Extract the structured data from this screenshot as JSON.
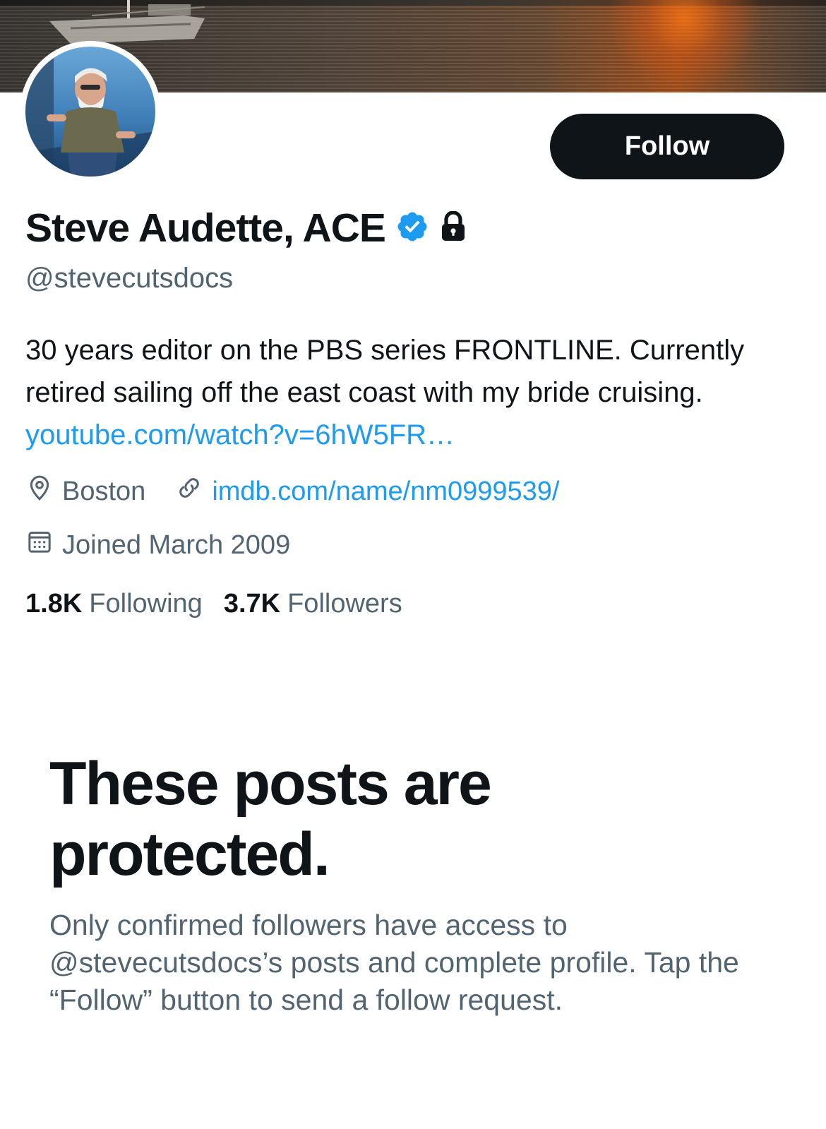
{
  "profile": {
    "name": "Steve Audette, ACE",
    "handle": "@stevecutsdocs",
    "follow_label": "Follow",
    "verified_icon": "verified-badge-icon",
    "lock_icon": "lock-icon",
    "bio_text": "30 years editor on the PBS series FRONTLINE. Currently retired sailing off the east coast with my bride cruising.",
    "bio_link": "youtube.com/watch?v=6hW5FR…",
    "location": "Boston",
    "website": "imdb.com/name/nm0999539/",
    "joined": "Joined March 2009",
    "following_count": "1.8K",
    "following_label": "Following",
    "followers_count": "3.7K",
    "followers_label": "Followers"
  },
  "protected": {
    "title": "These posts are protected.",
    "body": "Only confirmed followers have access to @stevecutsdocs’s posts and complete profile. Tap the “Follow” button to send a follow request."
  },
  "colors": {
    "text_primary": "#0f1419",
    "text_secondary": "#536471",
    "link": "#1d9bf0",
    "button_bg": "#0f1419"
  }
}
